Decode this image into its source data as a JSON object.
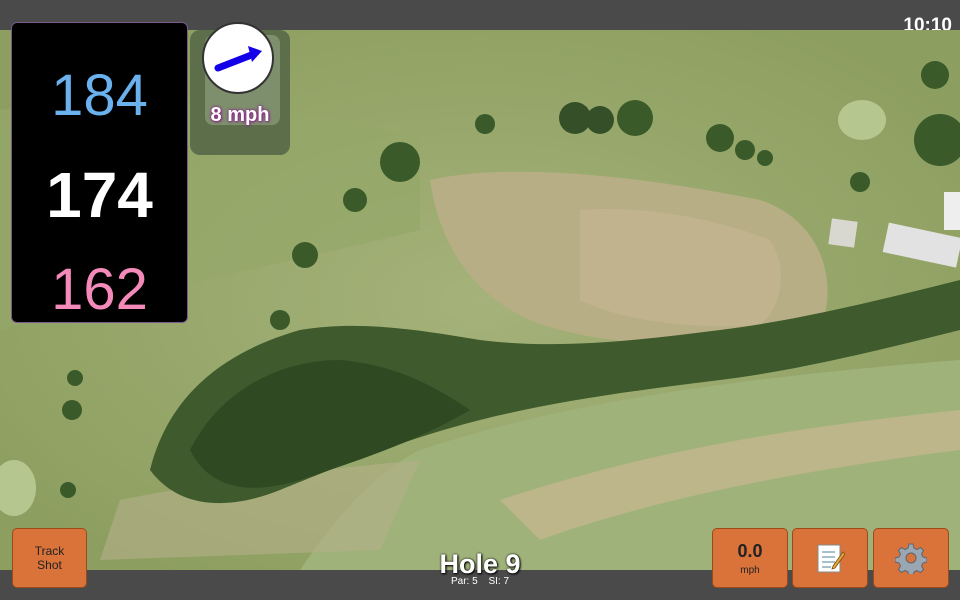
{
  "status_bar": {
    "time": "10:10"
  },
  "distances": {
    "back": "184",
    "middle": "174",
    "front": "162"
  },
  "wind": {
    "speed": "8 mph",
    "direction_icon": "arrow-east-icon",
    "arrow_color": "#1400e8"
  },
  "hole": {
    "title": "Hole 9",
    "par": "Par: 5",
    "stroke_index": "SI: 7"
  },
  "buttons": {
    "track_shot": "Track\nShot",
    "speed_value": "0.0",
    "speed_unit": "mph",
    "notes_icon": "notepad-icon",
    "settings_icon": "gear-icon"
  },
  "colors": {
    "back": "#6ab1ee",
    "middle": "#ffffff",
    "front": "#f48ab9",
    "button": "#d9733a",
    "bar": "#4a4a4a"
  }
}
